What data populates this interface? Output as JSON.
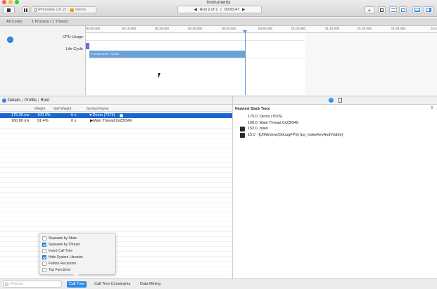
{
  "window": {
    "title": "Instruments"
  },
  "toolbar": {
    "stop_icon": "stop-icon",
    "pause_icon": "pause-icon",
    "device": "iPhone6& (10.2)",
    "app": "Demo",
    "run_label": "Run 2 of 2",
    "run_time": "00:00:47",
    "add_icon": "plus-icon"
  },
  "scope": {
    "all_cores": "All Cores",
    "process_thread": "1 Process / 1 Thread"
  },
  "tracks": {
    "cpu_usage": "CPU Usage",
    "life_cycle": "Life Cycle",
    "lifecycle_state": "Foreground - Active"
  },
  "ruler": [
    "00:00.000",
    "00:10.000",
    "00:20.000",
    "00:30.000",
    "00:40.000",
    "00:50.000",
    "01:00.000",
    "01:10.000",
    "01:20.000",
    "01:30.000",
    "01:4"
  ],
  "detail": {
    "crumbs": [
      "Details",
      "Profile",
      "Root"
    ],
    "columns": {
      "weight": "Weight",
      "self_weight": "Self Weight",
      "symbol": "Symbol Name"
    },
    "rows": [
      {
        "weight": "175.00 ms",
        "pct": "100.0%",
        "self": "0 s",
        "symbol": "▼Demo (7676)"
      },
      {
        "weight": "160.00 ms",
        "pct": "91.4%",
        "self": "0 s",
        "symbol": "▶Main Thread  0x23f349"
      }
    ]
  },
  "heaviest": {
    "title": "Heaviest Stack Trace",
    "items": [
      {
        "weight": "175.0",
        "label": "Demo (7676)"
      },
      {
        "weight": "160.0",
        "label": "Main Thread  0x23f349"
      },
      {
        "weight": "152.0",
        "label": "main"
      },
      {
        "weight": "15.0",
        "label": "-[UIWindow(DebugFPS) fps_makeKeyAndVisible]"
      }
    ]
  },
  "popover": {
    "options": [
      {
        "label": "Separate by State",
        "checked": false
      },
      {
        "label": "Separate by Thread",
        "checked": true
      },
      {
        "label": "Invert Call Tree",
        "checked": false
      },
      {
        "label": "Hide System Libraries",
        "checked": true
      },
      {
        "label": "Flatten Recursion",
        "checked": false
      },
      {
        "label": "Top Functions",
        "checked": false
      }
    ]
  },
  "bottom": {
    "filter_placeholder": "Process",
    "tabs": [
      "Call Tree",
      "Call Tree Constraints",
      "Data Mining"
    ]
  }
}
